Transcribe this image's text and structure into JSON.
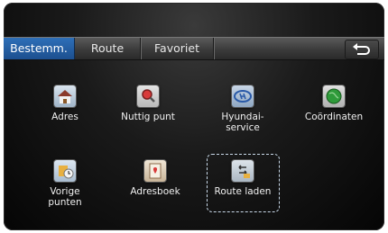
{
  "tabs": [
    {
      "label": "Bestemm.",
      "active": true
    },
    {
      "label": "Route",
      "active": false
    },
    {
      "label": "Favoriet",
      "active": false
    }
  ],
  "back_icon": "back-arrow-icon",
  "menu_items": [
    {
      "label": "Adres",
      "icon": "home-icon"
    },
    {
      "label": "Nuttig punt",
      "icon": "poi-search-icon"
    },
    {
      "label": "Hyundai-\nservice",
      "icon": "hyundai-logo-icon"
    },
    {
      "label": "Coördinaten",
      "icon": "globe-icon"
    },
    {
      "label": "Vorige\npunten",
      "icon": "previous-points-icon"
    },
    {
      "label": "Adresboek",
      "icon": "address-book-icon"
    },
    {
      "label": "Route laden",
      "icon": "route-load-icon"
    }
  ],
  "selected_item": "Route laden",
  "colors": {
    "active_tab": "#2466ad",
    "background": "#111111",
    "text": "#f0f0f0"
  }
}
